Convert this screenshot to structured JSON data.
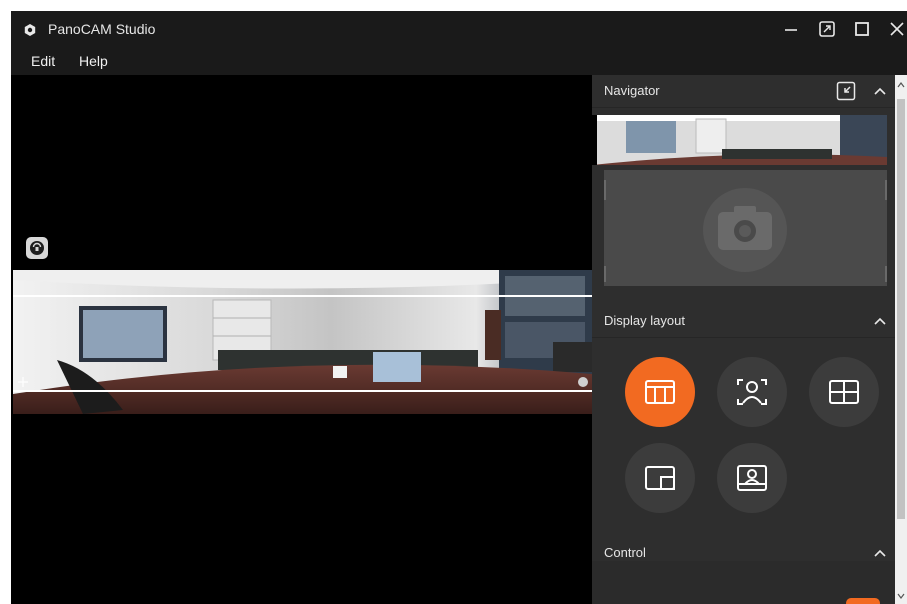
{
  "app": {
    "title": "PanoCAM Studio"
  },
  "menu": {
    "items": [
      "Edit",
      "Help"
    ]
  },
  "panel": {
    "navigator": {
      "title": "Navigator"
    },
    "display_layout": {
      "title": "Display layout",
      "selected": "panorama"
    },
    "control": {
      "title": "Control"
    }
  },
  "colors": {
    "accent": "#f26a21",
    "panel_bg": "#2e2e2e",
    "titlebar_bg": "#1a1a1a"
  },
  "icons": {
    "app": "panocam-logo-icon",
    "window": [
      "minimize-icon",
      "restore-icon",
      "maximize-icon",
      "close-icon"
    ],
    "layouts": [
      "panorama-layout-icon",
      "speaker-tracking-icon",
      "grid-layout-icon",
      "picture-in-picture-icon",
      "presenter-layout-icon"
    ]
  }
}
